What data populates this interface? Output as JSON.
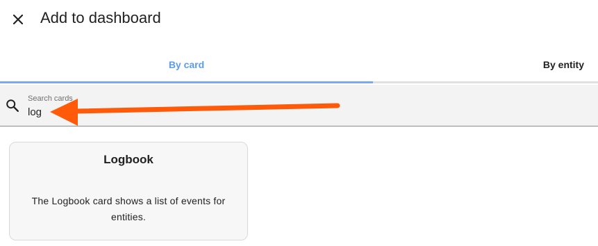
{
  "dialog": {
    "title": "Add to dashboard",
    "close_icon": "close-icon"
  },
  "tabs": [
    {
      "label": "By card",
      "active": true
    },
    {
      "label": "By entity",
      "active": false
    }
  ],
  "search": {
    "label": "Search cards",
    "value": "log",
    "icon": "search-icon"
  },
  "results": [
    {
      "title": "Logbook",
      "description": "The Logbook card shows a list of events for entities."
    }
  ],
  "annotation": {
    "type": "arrow",
    "color": "#ff5a0a",
    "points_to": "search-input"
  },
  "colors": {
    "active_tab": "#5b9bf0",
    "tab_indicator": "#7ba8f0",
    "search_background": "#f3f3f3",
    "card_background": "#f7f7f7"
  }
}
